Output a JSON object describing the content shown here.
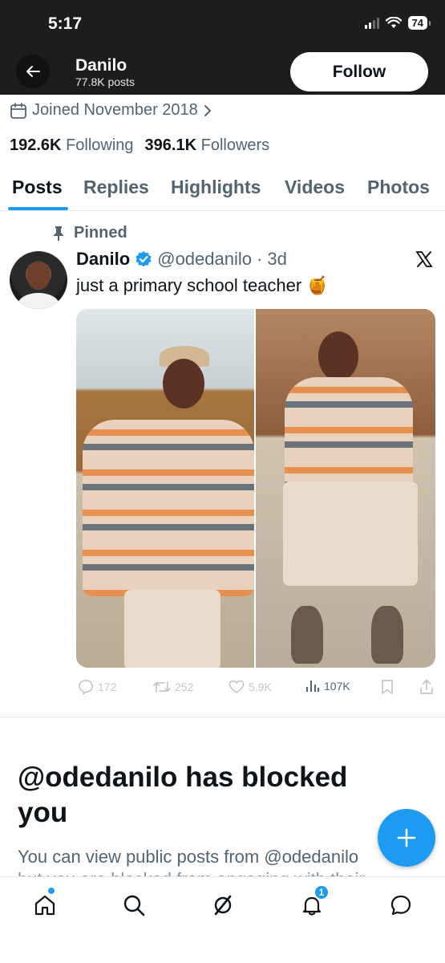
{
  "status_bar": {
    "time": "5:17",
    "battery": "74"
  },
  "header": {
    "name": "Danilo",
    "posts_count": "77.8K posts",
    "follow_label": "Follow"
  },
  "profile": {
    "joined": "Joined November 2018",
    "following_count": "192.6K",
    "following_label": "Following",
    "followers_count": "396.1K",
    "followers_label": "Followers"
  },
  "tabs": [
    {
      "label": "Posts",
      "active": true
    },
    {
      "label": "Replies",
      "active": false
    },
    {
      "label": "Highlights",
      "active": false
    },
    {
      "label": "Videos",
      "active": false
    },
    {
      "label": "Photos",
      "active": false
    }
  ],
  "post": {
    "pinned_label": "Pinned",
    "author_name": "Danilo",
    "handle": "@odedanilo",
    "separator": "·",
    "age": "3d",
    "text": "just a primary school teacher",
    "emoji": "🍯",
    "stats": {
      "replies": "172",
      "reposts": "252",
      "likes": "5.9K",
      "views": "107K"
    }
  },
  "blocked": {
    "title": "@odedanilo has blocked you",
    "text": "You can view public posts from @odedanilo",
    "text_cut": "but you are blocked from engaging with their posts"
  },
  "bottom_nav": {
    "notifications_badge": "1"
  },
  "colors": {
    "accent": "#1d9bf0",
    "header_bg": "#1c1d1f",
    "secondary_text": "#536471"
  }
}
